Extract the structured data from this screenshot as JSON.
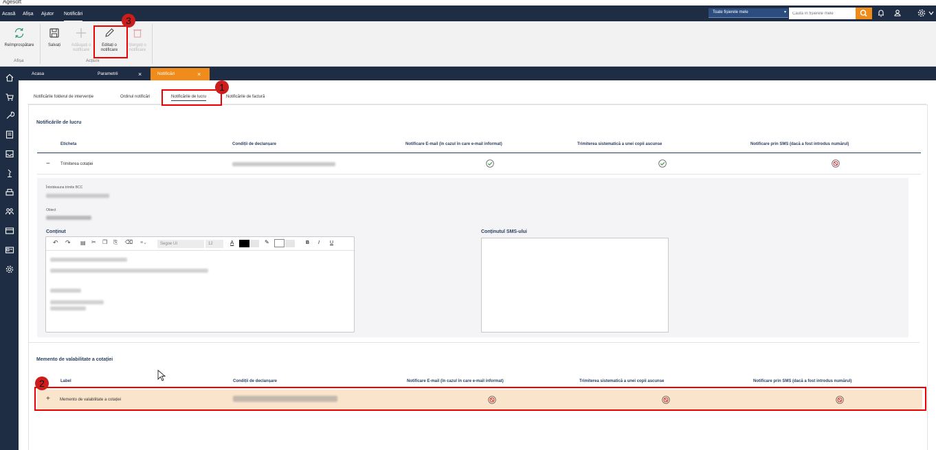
{
  "window": {
    "title": "Agesoft"
  },
  "menu": {
    "items": [
      "Acasă",
      "Afișa",
      "Ajutor",
      "Notificări"
    ],
    "active": "Notificări"
  },
  "search": {
    "scope": "Toate fișierele mele",
    "placeholder": "Caută în fișierele mele"
  },
  "ribbon": {
    "refresh": "Reîmprospătare",
    "save": "Salvați",
    "add": "Adăugați o notificare",
    "edit": "Editați o notificare",
    "delete": "Ștergeți o notificare",
    "group_display": "Afișa",
    "group_actions": "Acțiuni"
  },
  "tabs": [
    {
      "label": "Acasa"
    },
    {
      "label": "Parametrii",
      "close": "×"
    },
    {
      "label": "Notificări",
      "close": "×",
      "active": true
    }
  ],
  "subtabs": [
    "Notificările folderul de intervenție",
    "Ordinul notificări",
    "Notificările de lucru",
    "Notificările de factură"
  ],
  "active_subtab": "Notificările de lucru",
  "work_section": {
    "title": "Notificările de lucru",
    "headers": [
      "Eticheta",
      "Condiții de declanșare",
      "Notificare E-mail (în cazul în care e-mail informat)",
      "Trimiterea sistematică a unei copii ascunse",
      "Notificare prin SMS (dacă a fost introdus numărul)"
    ],
    "row": {
      "toggle": "−",
      "label": "Trimiterea cotației",
      "email": "check",
      "bcc": "check",
      "sms": "blocked"
    },
    "detail": {
      "bcc_label": "Întotdeauna trimite BCC",
      "subject_label": "Obiect",
      "content_label": "Conținut",
      "sms_label": "Conținutul SMS-ului",
      "font_name": "Segoe UI",
      "font_size": "12",
      "bold": "B",
      "italic": "I",
      "underline": "U"
    }
  },
  "reminder_section": {
    "title": "Memento de valabilitate a cotației",
    "headers": [
      "Label",
      "Condiții de declanșare",
      "Notificare E-mail (în cazul în care e-mail informat)",
      "Trimiterea sistematică a unei copii ascunse",
      "Notificare prin SMS (dacă a fost introdus numărul)"
    ],
    "row": {
      "toggle": "+",
      "label": "Memento de valabilitate a cotației",
      "email": "blocked",
      "bcc": "blocked",
      "sms": "blocked"
    }
  },
  "callouts": [
    "1",
    "2",
    "3"
  ],
  "colors": {
    "navy": "#1f2d44",
    "accent": "#f08c1b",
    "highlight_row": "#fbe4cc",
    "callout": "#e00000"
  }
}
